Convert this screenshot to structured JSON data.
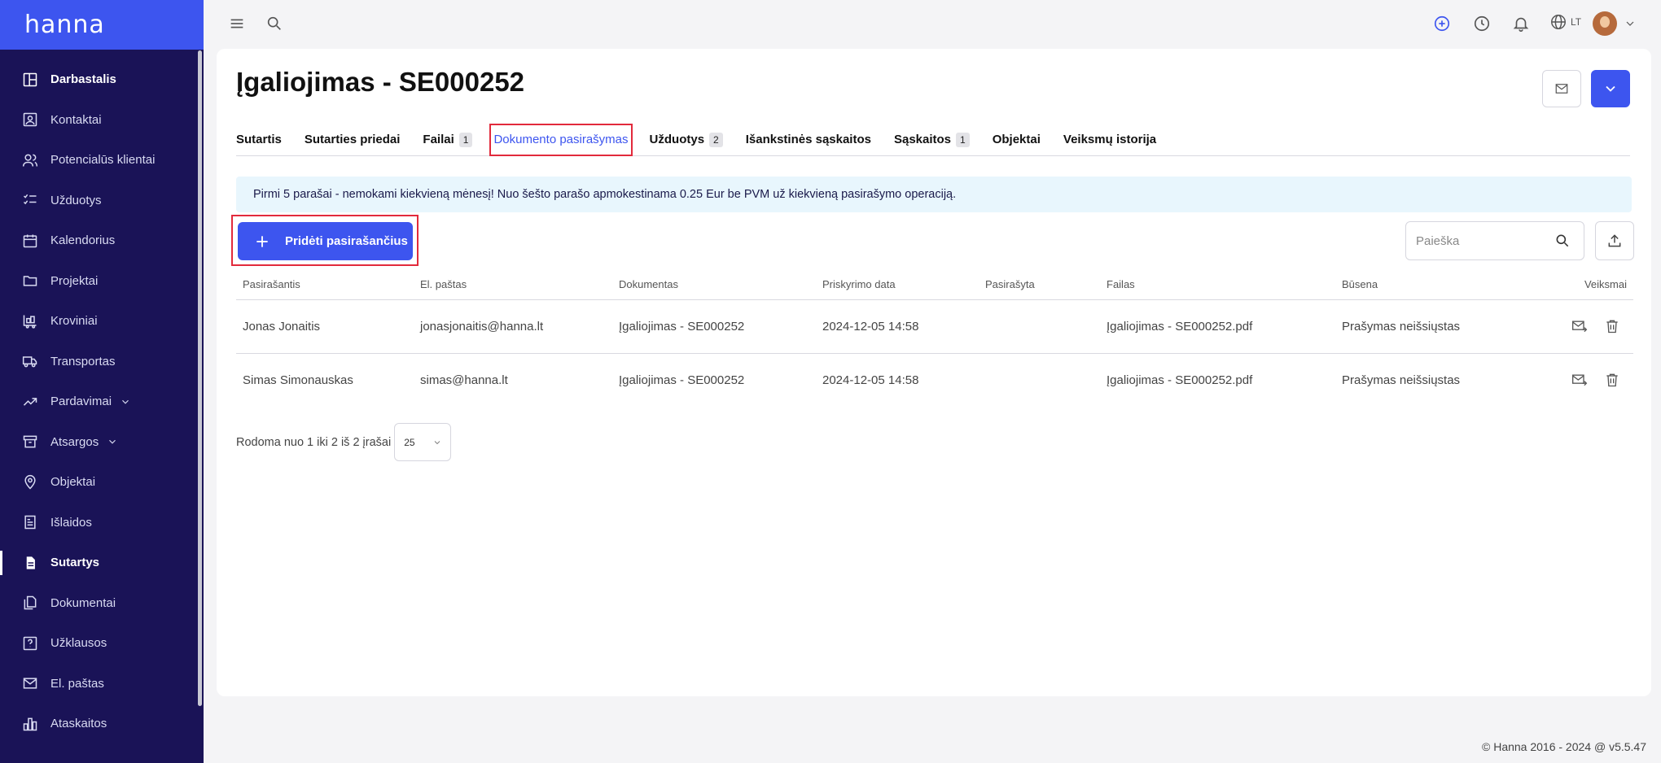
{
  "app": {
    "logo": "hanna"
  },
  "sidebar": {
    "items": [
      {
        "label": "Darbastalis",
        "icon": "dashboard-icon"
      },
      {
        "label": "Kontaktai",
        "icon": "contacts-icon"
      },
      {
        "label": "Potencialūs klientai",
        "icon": "leads-icon"
      },
      {
        "label": "Užduotys",
        "icon": "tasks-icon"
      },
      {
        "label": "Kalendorius",
        "icon": "calendar-icon"
      },
      {
        "label": "Projektai",
        "icon": "folder-icon"
      },
      {
        "label": "Kroviniai",
        "icon": "cargo-icon"
      },
      {
        "label": "Transportas",
        "icon": "truck-icon"
      },
      {
        "label": "Pardavimai",
        "icon": "trend-icon"
      },
      {
        "label": "Atsargos",
        "icon": "archive-icon"
      },
      {
        "label": "Objektai",
        "icon": "location-icon"
      },
      {
        "label": "Išlaidos",
        "icon": "receipt-icon"
      },
      {
        "label": "Sutartys",
        "icon": "contract-icon"
      },
      {
        "label": "Dokumentai",
        "icon": "documents-icon"
      },
      {
        "label": "Užklausos",
        "icon": "question-icon"
      },
      {
        "label": "El. paštas",
        "icon": "mail-icon"
      },
      {
        "label": "Ataskaitos",
        "icon": "reports-icon"
      }
    ]
  },
  "topbar": {
    "lang": "LT"
  },
  "page": {
    "title": "Įgaliojimas - SE000252"
  },
  "tabs": [
    {
      "label": "Sutartis"
    },
    {
      "label": "Sutarties priedai"
    },
    {
      "label": "Failai",
      "badge": "1"
    },
    {
      "label": "Dokumento pasirašymas"
    },
    {
      "label": "Užduotys",
      "badge": "2"
    },
    {
      "label": "Išankstinės sąskaitos"
    },
    {
      "label": "Sąskaitos",
      "badge": "1"
    },
    {
      "label": "Objektai"
    },
    {
      "label": "Veiksmų istorija"
    }
  ],
  "info_banner": "Pirmi 5 parašai - nemokami kiekvieną mėnesį! Nuo šešto parašo apmokestinama 0.25 Eur be PVM už kiekvieną pasirašymo operaciją.",
  "toolbar": {
    "add_label": "Pridėti pasirašančius",
    "search_placeholder": "Paieška"
  },
  "table": {
    "headers": [
      "Pasirašantis",
      "El. paštas",
      "Dokumentas",
      "Priskyrimo data",
      "Pasirašyta",
      "Failas",
      "Būsena",
      "Veiksmai"
    ],
    "rows": [
      [
        "Jonas Jonaitis",
        "jonasjonaitis@hanna.lt",
        "Įgaliojimas - SE000252",
        "2024-12-05 14:58",
        "",
        "Įgaliojimas - SE000252.pdf",
        "Prašymas neišsiųstas"
      ],
      [
        "Simas Simonauskas",
        "simas@hanna.lt",
        "Įgaliojimas - SE000252",
        "2024-12-05 14:58",
        "",
        "Įgaliojimas - SE000252.pdf",
        "Prašymas neišsiųstas"
      ]
    ]
  },
  "pagination": {
    "summary": "Rodoma nuo 1 iki 2 iš 2 įrašai",
    "page_size": "25"
  },
  "footer": {
    "copyright": "© Hanna 2016 - 2024 @ v5.5.47"
  },
  "colors": {
    "sidebar": "#1a1357",
    "accent": "#3d55ef",
    "highlight": "#e22a3c",
    "info_bg": "#e8f6fd"
  }
}
